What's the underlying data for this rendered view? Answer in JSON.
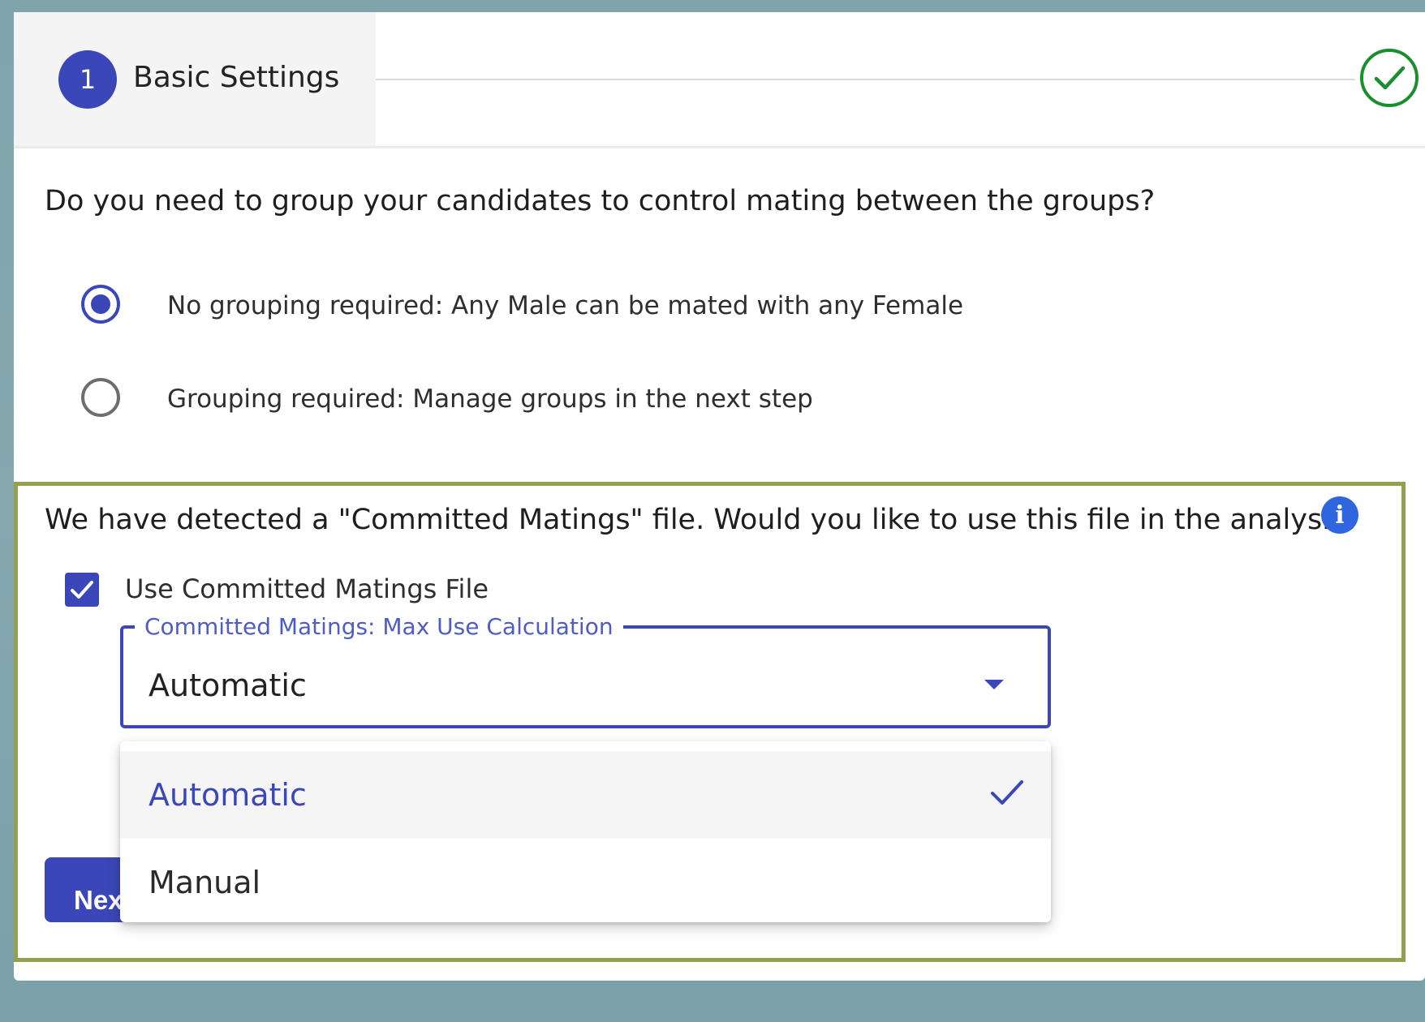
{
  "stepper": {
    "step_number": "1",
    "step_label": "Basic Settings",
    "completed_icon": "check-circle-icon"
  },
  "grouping": {
    "question": "Do you need to group your candidates to control mating between the groups?",
    "options": [
      {
        "label": "No grouping required: Any Male can be mated with any Female",
        "checked": true
      },
      {
        "label": "Grouping required: Manage groups in the next step",
        "checked": false
      }
    ]
  },
  "committed_matings": {
    "question": "We have detected a \"Committed Matings\" file. Would you like to use this file in the analysis?",
    "info_icon": "info-icon",
    "checkbox_label": "Use Committed Matings File",
    "checkbox_checked": true,
    "select_label": "Committed Matings: Max Use Calculation",
    "select_value": "Automatic",
    "menu_options": [
      {
        "label": "Automatic",
        "selected": true
      },
      {
        "label": "Manual",
        "selected": false
      }
    ]
  },
  "footer": {
    "next_label": "Next"
  },
  "colors": {
    "primary": "#3b47b8",
    "success": "#1a8f2e",
    "info": "#2f66e0",
    "highlight_border": "#95a04e"
  }
}
